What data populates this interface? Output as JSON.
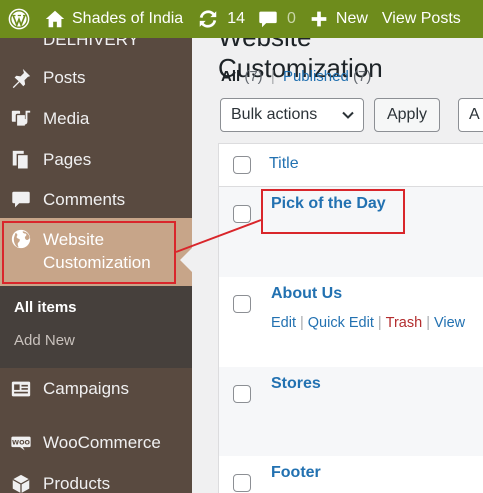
{
  "admin_bar": {
    "site_name": "Shades of India",
    "updates_count": "14",
    "comments_count": "0",
    "new_label": "New",
    "view_label": "View Posts",
    "bg_color": "#6e8c1c"
  },
  "sidebar": {
    "cut_item": "DELHIVERY",
    "items": [
      {
        "label": "Posts",
        "icon": "pushpin-icon"
      },
      {
        "label": "Media",
        "icon": "media-icon"
      },
      {
        "label": "Pages",
        "icon": "pages-icon"
      },
      {
        "label": "Comments",
        "icon": "comment-icon"
      }
    ],
    "current": {
      "label_line1": "Website",
      "label_line2": "Customization",
      "icon": "globe-icon"
    },
    "submenu": [
      {
        "label": "All items",
        "active": true
      },
      {
        "label": "Add New",
        "active": false
      }
    ],
    "items_after": [
      {
        "label": "Campaigns",
        "icon": "campaign-icon"
      },
      {
        "label": "WooCommerce",
        "icon": "woo-icon"
      },
      {
        "label": "Products",
        "icon": "products-icon"
      }
    ],
    "colors": {
      "bg": "#594a40",
      "current_bg": "#c7a589",
      "submenu_bg": "#46403c"
    }
  },
  "main": {
    "heading_cut": "Website Customization",
    "filters": {
      "all_label": "All",
      "all_count": "(7)",
      "separator": "|",
      "published_label": "Published",
      "published_count": "(7)"
    },
    "bulk_actions_label": "Bulk actions",
    "apply_label": "Apply",
    "filter_cut_label": "A",
    "table": {
      "column_title": "Title",
      "rows": [
        {
          "title": "Pick of the Day",
          "highlighted": true
        },
        {
          "title": "About Us",
          "actions": [
            "Edit",
            "Quick Edit",
            "Trash",
            "View"
          ]
        },
        {
          "title": "Stores"
        },
        {
          "title": "Footer"
        }
      ]
    }
  },
  "annotation": {
    "color": "#d9262b"
  }
}
